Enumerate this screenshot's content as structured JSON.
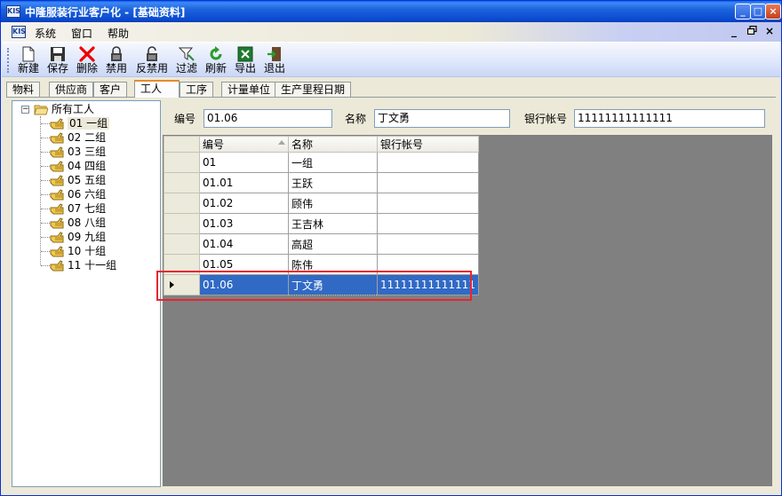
{
  "window": {
    "title": "中隆服装行业客户化 - [基础资料]",
    "icon_text": "KIS",
    "controls": {
      "minimize": "_",
      "maximize": "□",
      "close": "×"
    }
  },
  "menubar": {
    "icon_text": "KIS",
    "items": [
      "系统",
      "窗口",
      "帮助"
    ],
    "mdi_controls": {
      "minimize": "_",
      "restore": "🗗",
      "close": "×"
    }
  },
  "toolbar": {
    "buttons": [
      {
        "label": "新建",
        "icon": "new-document-icon"
      },
      {
        "label": "保存",
        "icon": "save-disk-icon"
      },
      {
        "label": "删除",
        "icon": "delete-x-icon"
      },
      {
        "label": "禁用",
        "icon": "lock-closed-icon"
      },
      {
        "label": "反禁用",
        "icon": "lock-open-icon"
      },
      {
        "label": "过滤",
        "icon": "filter-funnel-icon"
      },
      {
        "label": "刷新",
        "icon": "refresh-arrows-icon"
      },
      {
        "label": "导出",
        "icon": "excel-export-icon"
      },
      {
        "label": "退出",
        "icon": "exit-door-icon"
      }
    ]
  },
  "tabs": [
    {
      "label": "物料",
      "active": false
    },
    {
      "label": "供应商",
      "active": false
    },
    {
      "label": "客户",
      "active": false
    },
    {
      "label": "工人",
      "active": true
    },
    {
      "label": "工序",
      "active": false
    },
    {
      "label": "计量单位",
      "active": false
    },
    {
      "label": "生产里程日期",
      "active": false
    }
  ],
  "tree": {
    "root": {
      "label": "所有工人",
      "expanded": true,
      "toggle": "−"
    },
    "children": [
      {
        "label": "01 一组",
        "selected": true
      },
      {
        "label": "02 二组"
      },
      {
        "label": "03 三组"
      },
      {
        "label": "04 四组"
      },
      {
        "label": "05 五组"
      },
      {
        "label": "06 六组"
      },
      {
        "label": "07 七组"
      },
      {
        "label": "08 八组"
      },
      {
        "label": "09 九组"
      },
      {
        "label": "10 十组"
      },
      {
        "label": "11 十一组"
      }
    ]
  },
  "form": {
    "code_label": "编号",
    "code_value": "01.06",
    "name_label": "名称",
    "name_value": "丁文勇",
    "bank_label": "银行帐号",
    "bank_value": "11111111111111"
  },
  "grid": {
    "columns": [
      "编号",
      "名称",
      "银行帐号"
    ],
    "sorted_column": 0,
    "rows": [
      [
        "01",
        "一组",
        ""
      ],
      [
        "01.01",
        "王跃",
        ""
      ],
      [
        "01.02",
        "顾伟",
        ""
      ],
      [
        "01.03",
        "王吉林",
        ""
      ],
      [
        "01.04",
        "高超",
        ""
      ],
      [
        "01.05",
        "陈伟",
        ""
      ],
      [
        "01.06",
        "丁文勇",
        "11111111111111"
      ]
    ],
    "selected_row": 6
  },
  "colors": {
    "titlebar": "#0b4bd1",
    "selection": "#316ac5",
    "highlight_annotation": "#e8262f",
    "active_tab_accent": "#e68b2c"
  }
}
